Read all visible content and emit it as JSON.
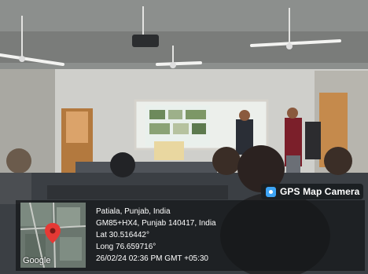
{
  "overlay": {
    "app_name": "GPS Map Camera",
    "location_title": "Patiala, Punjab, India",
    "address": "GM85+HX4, Punjab 140417, India",
    "latitude": "Lat 30.516442°",
    "longitude": "Long 76.659716°",
    "datetime": "26/02/24 02:36 PM GMT +05:30",
    "map_brand": "Google"
  },
  "screen": {
    "background_color": "#e9f0ec"
  }
}
